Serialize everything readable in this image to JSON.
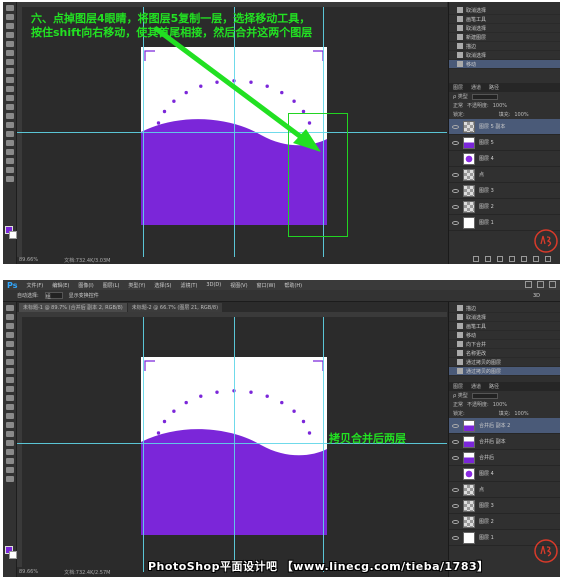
{
  "top": {
    "annotation_line1": "六、点掉图层4眼睛，将图层5复制一层，选择移动工具，",
    "annotation_line2": "按住shift向右移动，使其首尾相接，然后合并这两个图层",
    "zoom": "89.66%",
    "doc_info": "文档:732.4K/3.03M",
    "history": [
      "取消选择",
      "画笔工具",
      "取消选择",
      "新建图层",
      "描边",
      "取消选择",
      "移动"
    ],
    "panel_tabs": [
      "图层",
      "通道",
      "路径"
    ],
    "kind_label": "ρ 类型",
    "blend_mode": "正常",
    "opacity_label": "不透明度:",
    "opacity": "100%",
    "lock_label": "锁定:",
    "fill_label": "填充:",
    "fill": "100%",
    "layers": [
      "图层 5 副本",
      "图层 5",
      "图层 4",
      "点",
      "图层 3",
      "图层 2",
      "图层 1"
    ]
  },
  "bottom": {
    "app_logo": "Ps",
    "menu": [
      "文件(F)",
      "编辑(E)",
      "图像(I)",
      "图层(L)",
      "类型(Y)",
      "选择(S)",
      "滤镜(T)",
      "3D(D)",
      "视图(V)",
      "窗口(W)",
      "帮助(H)"
    ],
    "option_label": "自动选择:",
    "option_value": "组",
    "transform_label": "显示变换控件",
    "doc_tabs": [
      "未标题-1 @ 89.7% (合并后 副本 2, RGB/8)",
      "未标题-2 @ 66.7% (图层 21, RGB/8)"
    ],
    "workspace": "3D",
    "history": [
      "描边",
      "取消选择",
      "画笔工具",
      "移动",
      "向下合并",
      "名称更改",
      "通过拷贝的图层",
      "通过拷贝的图层"
    ],
    "panel_tabs": [
      "图层",
      "通道",
      "路径"
    ],
    "kind_label": "ρ 类型",
    "blend_mode": "正常",
    "opacity_label": "不透明度:",
    "opacity": "100%",
    "lock_label": "锁定:",
    "fill_label": "填充:",
    "fill": "100%",
    "layers": [
      "合并后 副本 2",
      "合并后 副本",
      "合并后",
      "图层 4",
      "点",
      "图层 3",
      "图层 2",
      "图层 1"
    ],
    "annotation": "拷贝合并后两层",
    "zoom": "89.66%",
    "doc_info": "文档:732.4K/2.57M"
  },
  "footer": "PhotoShop平面设计吧 【www.linecg.com/tieba/1783】",
  "colors": {
    "purple": "#7b26d9",
    "annotation_green": "#22e022",
    "guide_cyan": "#5fd6e8",
    "selection": "#4a5a78"
  }
}
